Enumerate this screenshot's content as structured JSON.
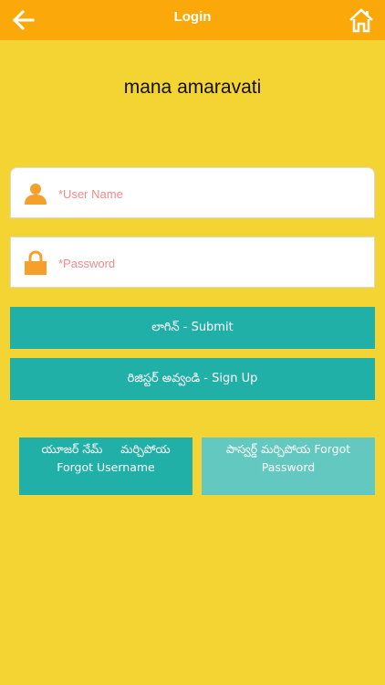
{
  "header": {
    "title": "Login"
  },
  "app": {
    "name": "mana amaravati"
  },
  "form": {
    "username_placeholder": "*User Name",
    "password_placeholder": "*Password",
    "submit_label": "లాగిన్ - Submit",
    "signup_label": "రిజిస్టర్ అవ్వండి - Sign Up",
    "forgot_username_te": "యూజర్ నేమ్     మర్చిపోయ",
    "forgot_username_en": "Forgot Username",
    "forgot_password_te": "పాస్వర్డ్ మర్చిపోయ Forgot",
    "forgot_password_en": "Password"
  },
  "icons": {
    "back": "arrow-left-icon",
    "home": "home-icon",
    "user": "user-icon",
    "lock": "lock-icon"
  },
  "colors": {
    "background": "#F4D432",
    "header": "#FBA90A",
    "button": "#21B0A8",
    "button_light": "#62C8C0",
    "icon_accent": "#F5A02A"
  }
}
